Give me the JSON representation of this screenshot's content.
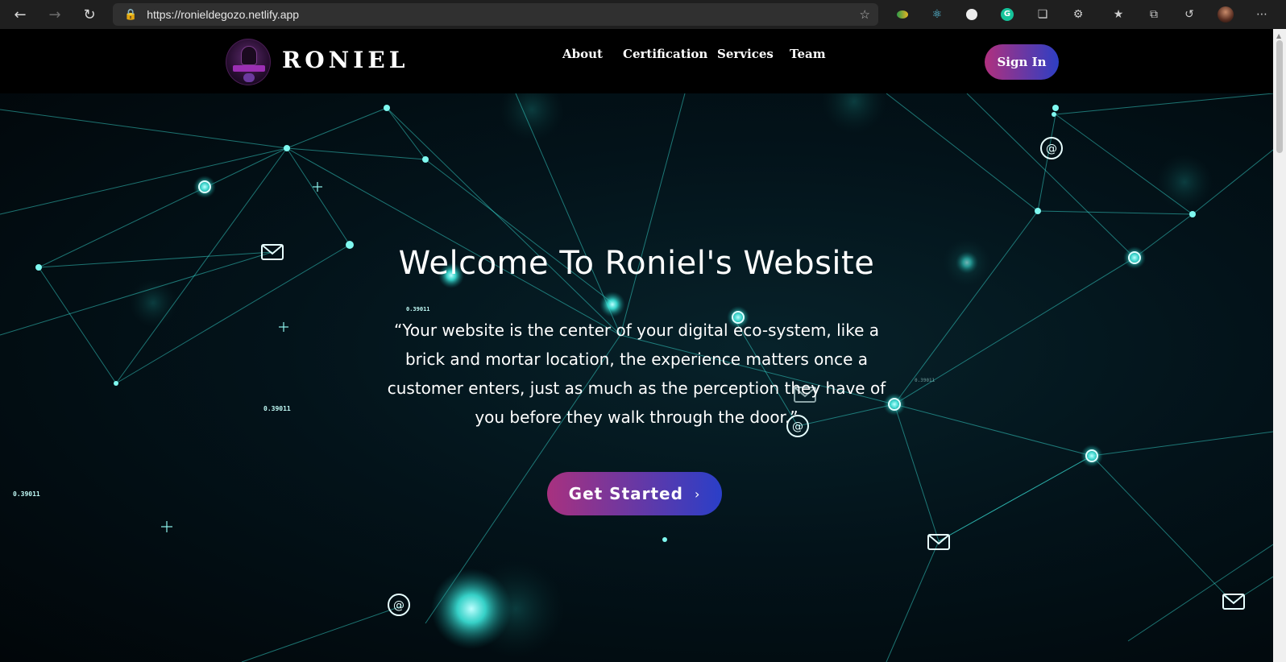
{
  "browser": {
    "url": "https://ronieldegozo.netlify.app",
    "back_icon": "arrow-left-icon",
    "forward_icon": "arrow-right-icon",
    "refresh_icon": "refresh-icon",
    "lock_icon": "lock-icon",
    "extensions": [
      "favorite-add-icon",
      "colorful-extension-icon",
      "react-devtools-icon",
      "circle-extension-icon",
      "grammarly-icon",
      "collections-extension-icon",
      "puzzle-icon",
      "favorites-icon",
      "collections-icon",
      "history-icon",
      "profile-avatar",
      "more-icon"
    ]
  },
  "header": {
    "logo_text": "RONIEL",
    "nav": [
      "About",
      "Certification",
      "Services",
      "Team"
    ],
    "signin_label": "Sign In"
  },
  "hero": {
    "title": "Welcome To Roniel's Website",
    "quote": "“Your website is the center of your digital eco-system, like a brick and mortar location, the experience matters once a customer enters, just as much as the perception they have of you before they walk through the door.”",
    "cta_label": "Get Started",
    "cta_icon": "chevron-right-icon",
    "bg_numbers": [
      "0.39011",
      "0.39011",
      "0.39011",
      "0.39011"
    ]
  },
  "colors": {
    "accent_start": "#a8317f",
    "accent_end": "#2a3fc8",
    "network_cyan": "#3ff2e6"
  }
}
